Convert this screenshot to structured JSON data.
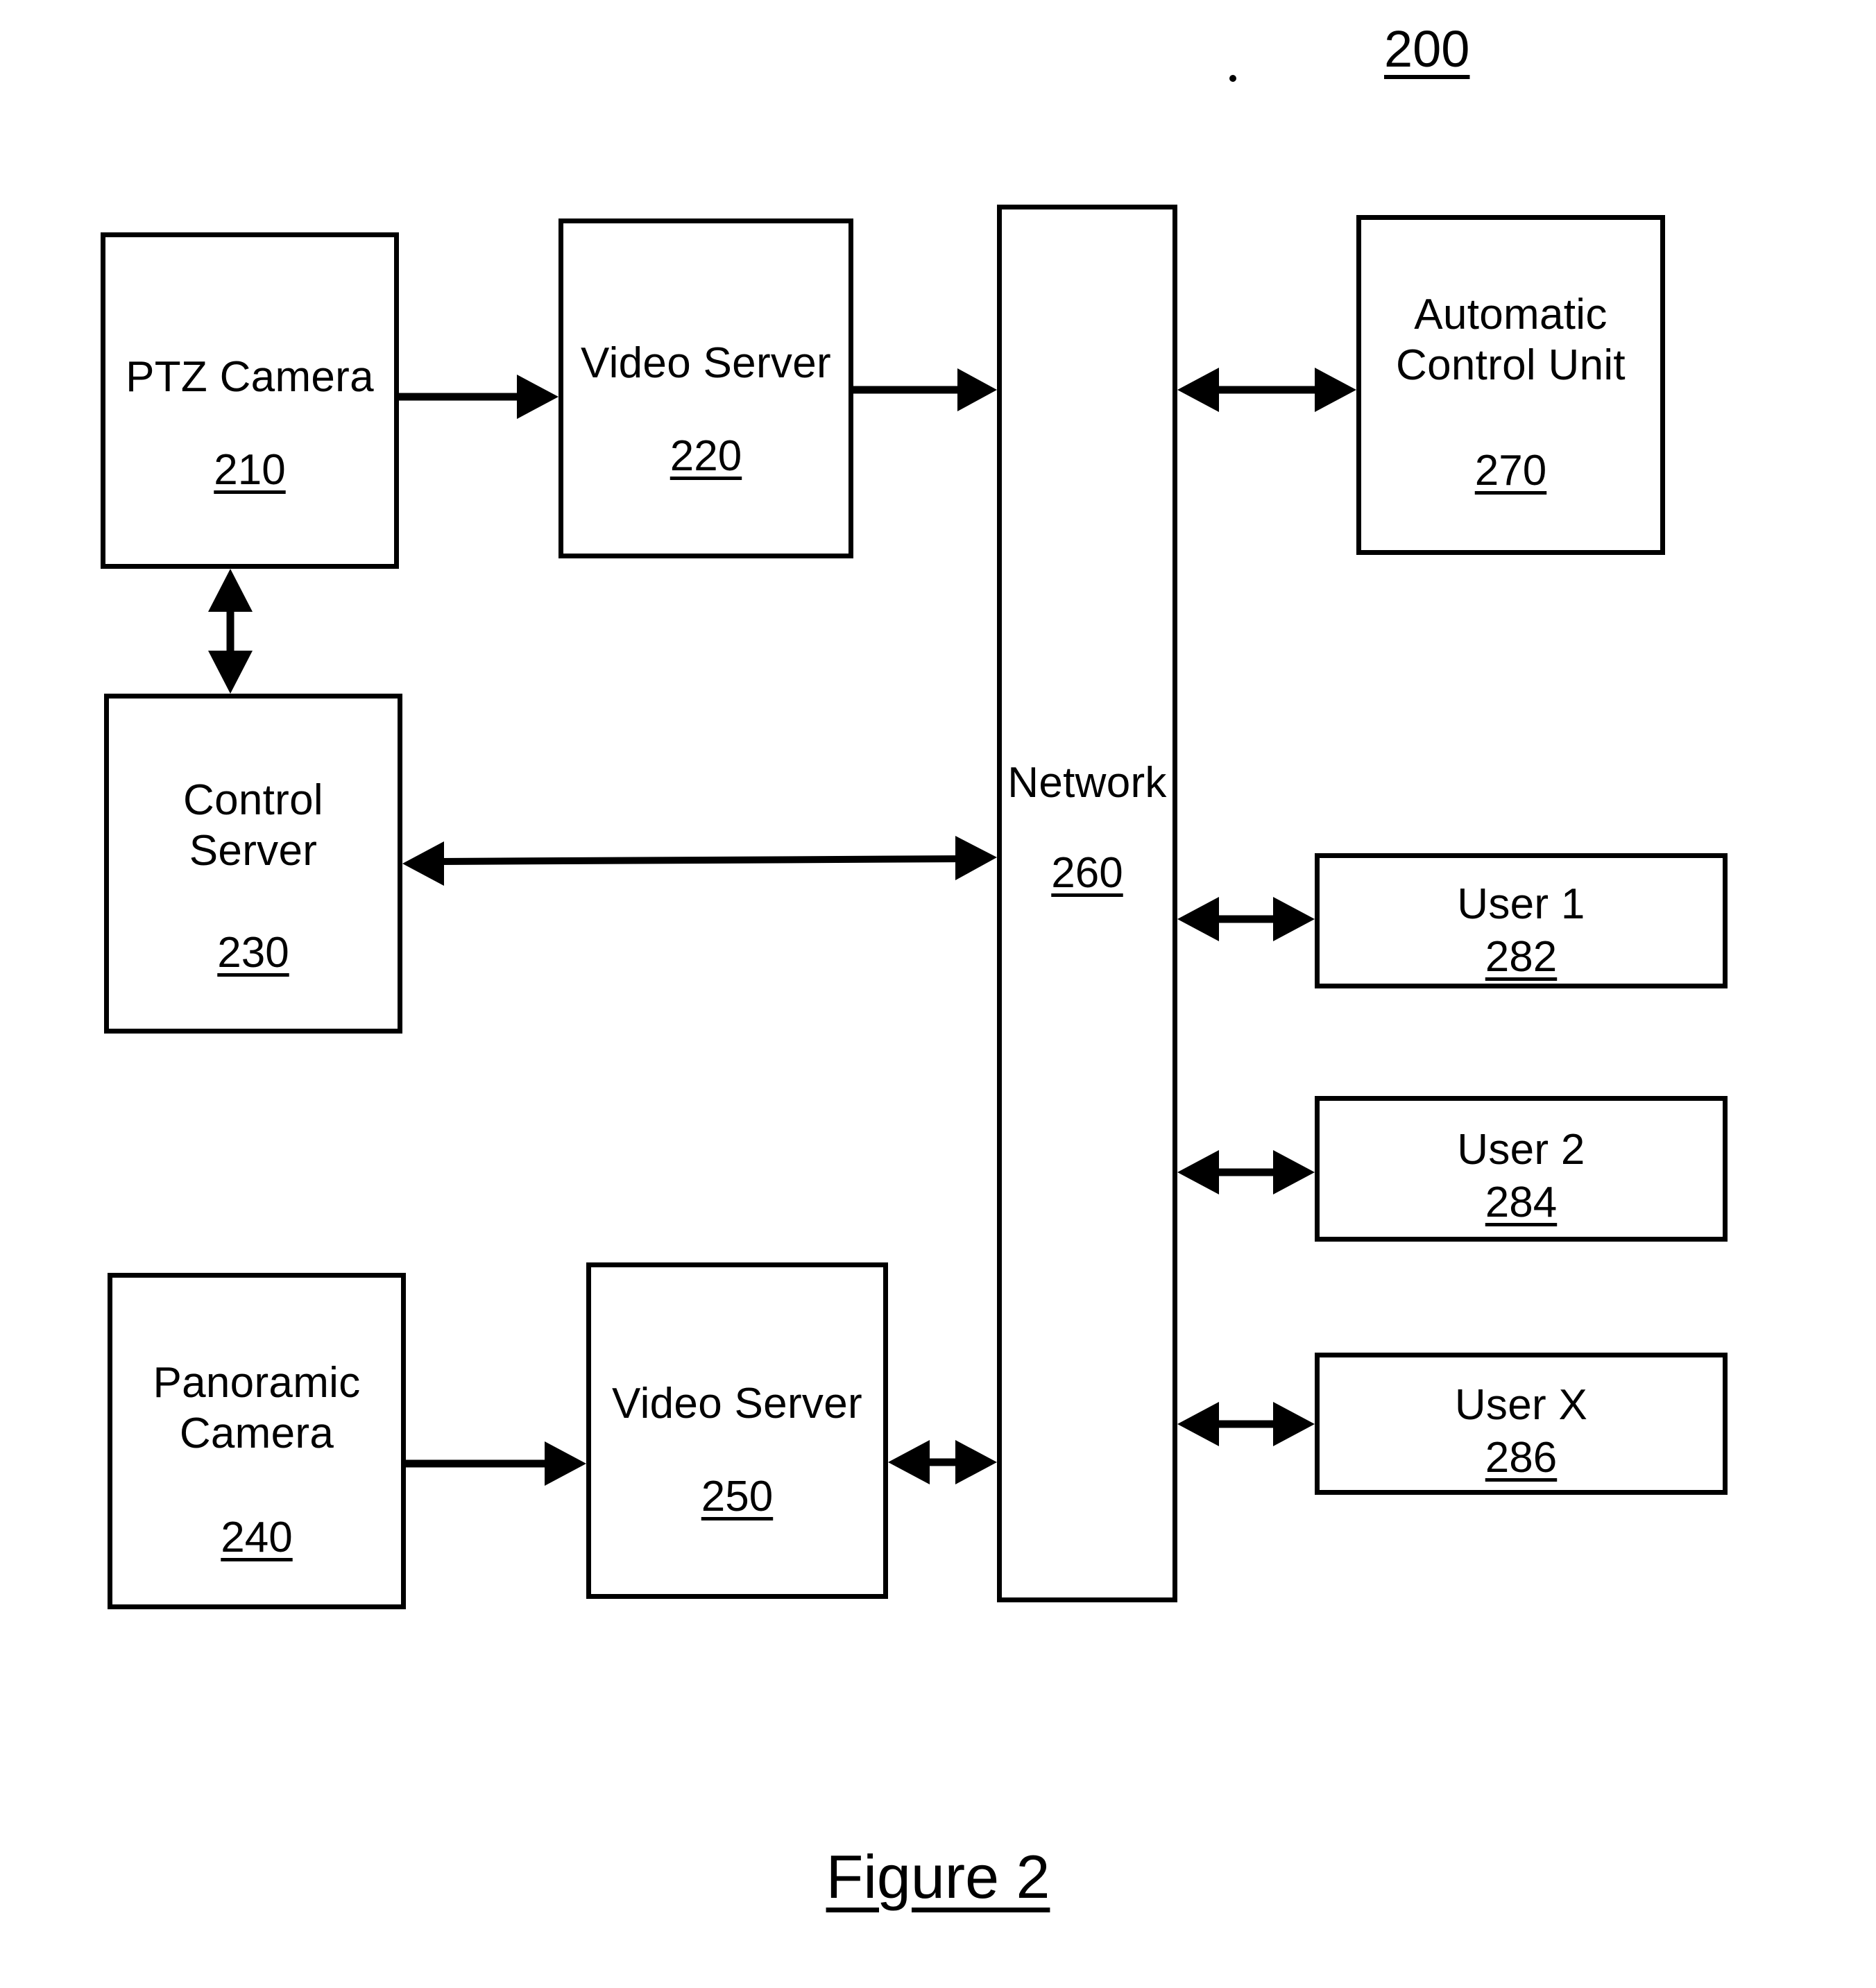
{
  "figure": {
    "assembly_ref": "200",
    "caption": "Figure 2"
  },
  "blocks": [
    {
      "id": "ptz-camera",
      "title": "PTZ Camera",
      "ref": "210"
    },
    {
      "id": "video-server-220",
      "title": "Video Server",
      "ref": "220"
    },
    {
      "id": "control-server",
      "title": "Control\nServer",
      "ref": "230"
    },
    {
      "id": "panoramic-camera",
      "title": "Panoramic\nCamera",
      "ref": "240"
    },
    {
      "id": "video-server-250",
      "title": "Video Server",
      "ref": "250"
    },
    {
      "id": "network-bus",
      "title": "Network",
      "ref": "260"
    },
    {
      "id": "automatic-control-unit",
      "title": "Automatic\nControl Unit",
      "ref": "270"
    },
    {
      "id": "user-1",
      "title": "User 1",
      "ref": "282"
    },
    {
      "id": "user-2",
      "title": "User 2",
      "ref": "284"
    },
    {
      "id": "user-x",
      "title": "User X",
      "ref": "286"
    }
  ],
  "connections": [
    {
      "from": "ptz-camera",
      "to": "video-server-220",
      "direction": "one-way"
    },
    {
      "from": "video-server-220",
      "to": "network-bus",
      "direction": "one-way"
    },
    {
      "from": "ptz-camera",
      "to": "control-server",
      "direction": "two-way"
    },
    {
      "from": "control-server",
      "to": "network-bus",
      "direction": "two-way"
    },
    {
      "from": "network-bus",
      "to": "automatic-control-unit",
      "direction": "two-way"
    },
    {
      "from": "network-bus",
      "to": "user-1",
      "direction": "two-way"
    },
    {
      "from": "network-bus",
      "to": "user-2",
      "direction": "two-way"
    },
    {
      "from": "network-bus",
      "to": "user-x",
      "direction": "two-way"
    },
    {
      "from": "panoramic-camera",
      "to": "video-server-250",
      "direction": "one-way"
    },
    {
      "from": "video-server-250",
      "to": "network-bus",
      "direction": "two-way"
    }
  ],
  "colors": {
    "ink": "#000000",
    "paper": "#ffffff"
  }
}
